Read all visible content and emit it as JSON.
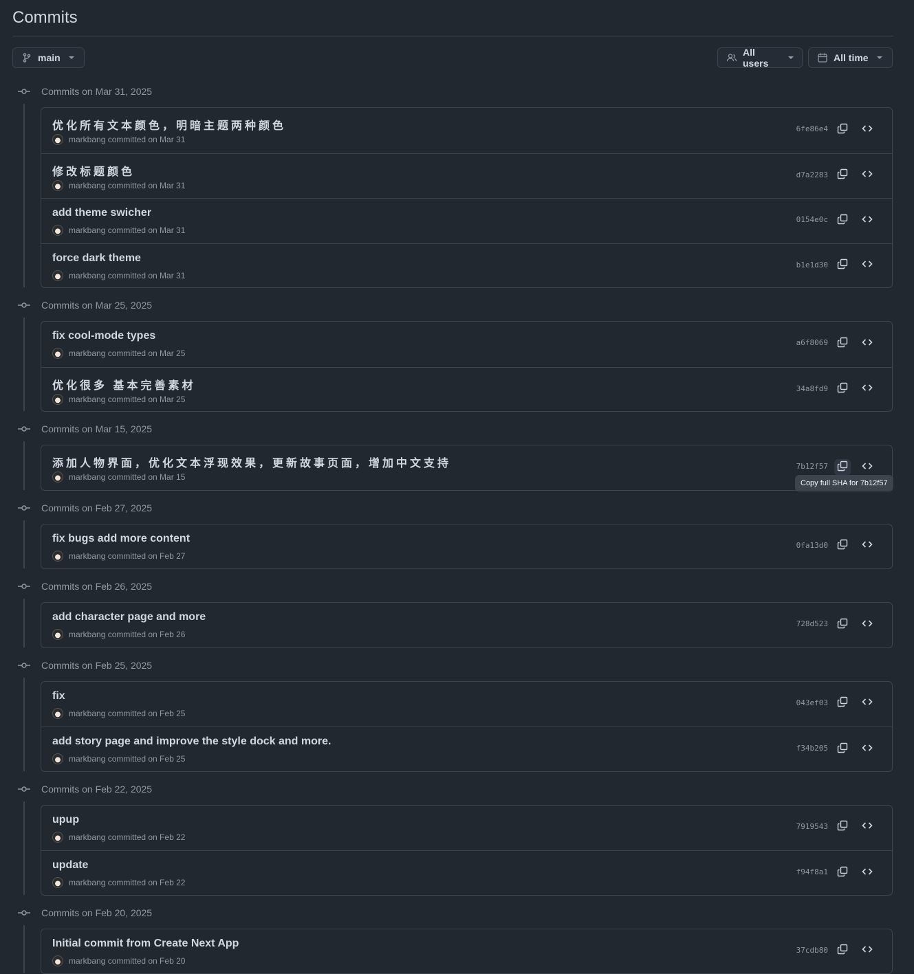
{
  "page": {
    "title": "Commits"
  },
  "branch": {
    "label": "main"
  },
  "filters": {
    "users_label": "All users",
    "time_label": "All time"
  },
  "tooltip": {
    "text": "Copy full SHA for 7b12f57"
  },
  "groups": [
    {
      "heading": "Commits on Mar 31, 2025",
      "commits": [
        {
          "message": "优化所有文本颜色，明暗主题两种颜色",
          "meta": "markbang committed on Mar 31",
          "sha": "6fe86e4"
        },
        {
          "message": "修改标题颜色",
          "meta": "markbang committed on Mar 31",
          "sha": "d7a2283"
        },
        {
          "message": "add theme swicher",
          "meta": "markbang committed on Mar 31",
          "sha": "0154e0c"
        },
        {
          "message": "force dark theme",
          "meta": "markbang committed on Mar 31",
          "sha": "b1e1d30"
        }
      ]
    },
    {
      "heading": "Commits on Mar 25, 2025",
      "commits": [
        {
          "message": "fix cool-mode types",
          "meta": "markbang committed on Mar 25",
          "sha": "a6f8069"
        },
        {
          "message": "优化很多 基本完善素材",
          "meta": "markbang committed on Mar 25",
          "sha": "34a8fd9"
        }
      ]
    },
    {
      "heading": "Commits on Mar 15, 2025",
      "commits": [
        {
          "message": "添加人物界面，优化文本浮现效果，更新故事页面，增加中文支持",
          "meta": "markbang committed on Mar 15",
          "sha": "7b12f57"
        }
      ]
    },
    {
      "heading": "Commits on Feb 27, 2025",
      "commits": [
        {
          "message": "fix bugs add more content",
          "meta": "markbang committed on Feb 27",
          "sha": "0fa13d0"
        }
      ]
    },
    {
      "heading": "Commits on Feb 26, 2025",
      "commits": [
        {
          "message": "add character page and more",
          "meta": "markbang committed on Feb 26",
          "sha": "728d523"
        }
      ]
    },
    {
      "heading": "Commits on Feb 25, 2025",
      "commits": [
        {
          "message": "fix",
          "meta": "markbang committed on Feb 25",
          "sha": "043ef03"
        },
        {
          "message": "add story page and improve the style dock and more.",
          "meta": "markbang committed on Feb 25",
          "sha": "f34b205"
        }
      ]
    },
    {
      "heading": "Commits on Feb 22, 2025",
      "commits": [
        {
          "message": "upup",
          "meta": "markbang committed on Feb 22",
          "sha": "7919543"
        },
        {
          "message": "update",
          "meta": "markbang committed on Feb 22",
          "sha": "f94f8a1"
        }
      ]
    },
    {
      "heading": "Commits on Feb 20, 2025",
      "commits": [
        {
          "message": "Initial commit from Create Next App",
          "meta": "markbang committed on Feb 20",
          "sha": "37cdb80"
        }
      ]
    }
  ]
}
